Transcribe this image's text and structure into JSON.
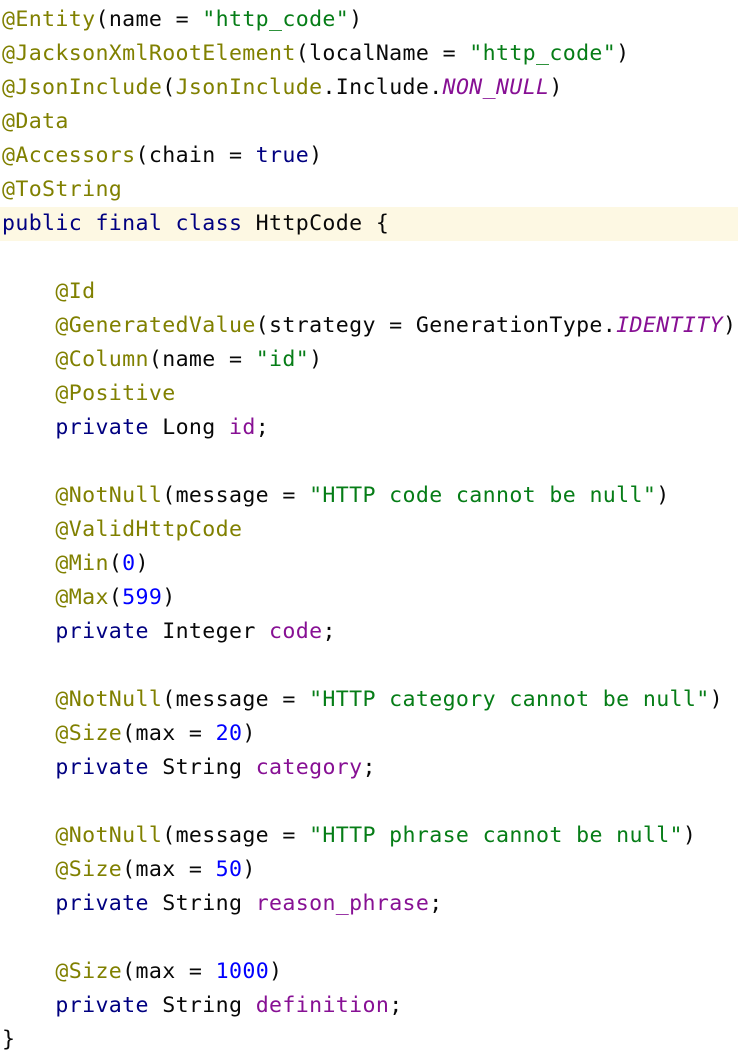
{
  "editor": {
    "language": "java",
    "highlighted_line": 7,
    "colors": {
      "background": "#ffffff",
      "current_line": "#fdf8e3",
      "annotation": "#808000",
      "string": "#067d17",
      "keyword": "#000080",
      "number": "#0000ff",
      "field": "#871094",
      "static_constant": "#871094",
      "plain": "#080808"
    },
    "lines": [
      {
        "tokens": [
          {
            "t": "annotation",
            "v": "@Entity"
          },
          {
            "t": "plain",
            "v": "(name = "
          },
          {
            "t": "string",
            "v": "\"http_code\""
          },
          {
            "t": "plain",
            "v": ")"
          }
        ]
      },
      {
        "tokens": [
          {
            "t": "annotation",
            "v": "@JacksonXmlRootElement"
          },
          {
            "t": "plain",
            "v": "(localName = "
          },
          {
            "t": "string",
            "v": "\"http_code\""
          },
          {
            "t": "plain",
            "v": ")"
          }
        ]
      },
      {
        "tokens": [
          {
            "t": "annotation",
            "v": "@JsonInclude"
          },
          {
            "t": "plain",
            "v": "("
          },
          {
            "t": "annotation",
            "v": "JsonInclude"
          },
          {
            "t": "plain",
            "v": ".Include."
          },
          {
            "t": "static",
            "v": "NON_NULL"
          },
          {
            "t": "plain",
            "v": ")"
          }
        ]
      },
      {
        "tokens": [
          {
            "t": "annotation",
            "v": "@Data"
          }
        ]
      },
      {
        "tokens": [
          {
            "t": "annotation",
            "v": "@Accessors"
          },
          {
            "t": "plain",
            "v": "(chain = "
          },
          {
            "t": "keyword",
            "v": "true"
          },
          {
            "t": "plain",
            "v": ")"
          }
        ]
      },
      {
        "tokens": [
          {
            "t": "annotation",
            "v": "@ToString"
          }
        ]
      },
      {
        "tokens": [
          {
            "t": "keyword",
            "v": "public final class "
          },
          {
            "t": "plain",
            "v": "HttpCode {"
          }
        ]
      },
      {
        "tokens": []
      },
      {
        "tokens": [
          {
            "t": "plain",
            "v": "    "
          },
          {
            "t": "annotation",
            "v": "@Id"
          }
        ]
      },
      {
        "tokens": [
          {
            "t": "plain",
            "v": "    "
          },
          {
            "t": "annotation",
            "v": "@GeneratedValue"
          },
          {
            "t": "plain",
            "v": "(strategy = GenerationType."
          },
          {
            "t": "static",
            "v": "IDENTITY"
          },
          {
            "t": "plain",
            "v": ")"
          }
        ]
      },
      {
        "tokens": [
          {
            "t": "plain",
            "v": "    "
          },
          {
            "t": "annotation",
            "v": "@Column"
          },
          {
            "t": "plain",
            "v": "(name = "
          },
          {
            "t": "string",
            "v": "\"id\""
          },
          {
            "t": "plain",
            "v": ")"
          }
        ]
      },
      {
        "tokens": [
          {
            "t": "plain",
            "v": "    "
          },
          {
            "t": "annotation",
            "v": "@Positive"
          }
        ]
      },
      {
        "tokens": [
          {
            "t": "plain",
            "v": "    "
          },
          {
            "t": "keyword",
            "v": "private "
          },
          {
            "t": "plain",
            "v": "Long "
          },
          {
            "t": "field",
            "v": "id"
          },
          {
            "t": "plain",
            "v": ";"
          }
        ]
      },
      {
        "tokens": []
      },
      {
        "tokens": [
          {
            "t": "plain",
            "v": "    "
          },
          {
            "t": "annotation",
            "v": "@NotNull"
          },
          {
            "t": "plain",
            "v": "(message = "
          },
          {
            "t": "string",
            "v": "\"HTTP code cannot be null\""
          },
          {
            "t": "plain",
            "v": ")"
          }
        ]
      },
      {
        "tokens": [
          {
            "t": "plain",
            "v": "    "
          },
          {
            "t": "annotation",
            "v": "@ValidHttpCode"
          }
        ]
      },
      {
        "tokens": [
          {
            "t": "plain",
            "v": "    "
          },
          {
            "t": "annotation",
            "v": "@Min"
          },
          {
            "t": "plain",
            "v": "("
          },
          {
            "t": "number",
            "v": "0"
          },
          {
            "t": "plain",
            "v": ")"
          }
        ]
      },
      {
        "tokens": [
          {
            "t": "plain",
            "v": "    "
          },
          {
            "t": "annotation",
            "v": "@Max"
          },
          {
            "t": "plain",
            "v": "("
          },
          {
            "t": "number",
            "v": "599"
          },
          {
            "t": "plain",
            "v": ")"
          }
        ]
      },
      {
        "tokens": [
          {
            "t": "plain",
            "v": "    "
          },
          {
            "t": "keyword",
            "v": "private "
          },
          {
            "t": "plain",
            "v": "Integer "
          },
          {
            "t": "field",
            "v": "code"
          },
          {
            "t": "plain",
            "v": ";"
          }
        ]
      },
      {
        "tokens": []
      },
      {
        "tokens": [
          {
            "t": "plain",
            "v": "    "
          },
          {
            "t": "annotation",
            "v": "@NotNull"
          },
          {
            "t": "plain",
            "v": "(message = "
          },
          {
            "t": "string",
            "v": "\"HTTP category cannot be null\""
          },
          {
            "t": "plain",
            "v": ")"
          }
        ]
      },
      {
        "tokens": [
          {
            "t": "plain",
            "v": "    "
          },
          {
            "t": "annotation",
            "v": "@Size"
          },
          {
            "t": "plain",
            "v": "(max = "
          },
          {
            "t": "number",
            "v": "20"
          },
          {
            "t": "plain",
            "v": ")"
          }
        ]
      },
      {
        "tokens": [
          {
            "t": "plain",
            "v": "    "
          },
          {
            "t": "keyword",
            "v": "private "
          },
          {
            "t": "plain",
            "v": "String "
          },
          {
            "t": "field",
            "v": "category"
          },
          {
            "t": "plain",
            "v": ";"
          }
        ]
      },
      {
        "tokens": []
      },
      {
        "tokens": [
          {
            "t": "plain",
            "v": "    "
          },
          {
            "t": "annotation",
            "v": "@NotNull"
          },
          {
            "t": "plain",
            "v": "(message = "
          },
          {
            "t": "string",
            "v": "\"HTTP phrase cannot be null\""
          },
          {
            "t": "plain",
            "v": ")"
          }
        ]
      },
      {
        "tokens": [
          {
            "t": "plain",
            "v": "    "
          },
          {
            "t": "annotation",
            "v": "@Size"
          },
          {
            "t": "plain",
            "v": "(max = "
          },
          {
            "t": "number",
            "v": "50"
          },
          {
            "t": "plain",
            "v": ")"
          }
        ]
      },
      {
        "tokens": [
          {
            "t": "plain",
            "v": "    "
          },
          {
            "t": "keyword",
            "v": "private "
          },
          {
            "t": "plain",
            "v": "String "
          },
          {
            "t": "field",
            "v": "reason_phrase"
          },
          {
            "t": "plain",
            "v": ";"
          }
        ]
      },
      {
        "tokens": []
      },
      {
        "tokens": [
          {
            "t": "plain",
            "v": "    "
          },
          {
            "t": "annotation",
            "v": "@Size"
          },
          {
            "t": "plain",
            "v": "(max = "
          },
          {
            "t": "number",
            "v": "1000"
          },
          {
            "t": "plain",
            "v": ")"
          }
        ]
      },
      {
        "tokens": [
          {
            "t": "plain",
            "v": "    "
          },
          {
            "t": "keyword",
            "v": "private "
          },
          {
            "t": "plain",
            "v": "String "
          },
          {
            "t": "field",
            "v": "definition"
          },
          {
            "t": "plain",
            "v": ";"
          }
        ]
      },
      {
        "tokens": [
          {
            "t": "plain",
            "v": "}"
          }
        ]
      }
    ]
  }
}
